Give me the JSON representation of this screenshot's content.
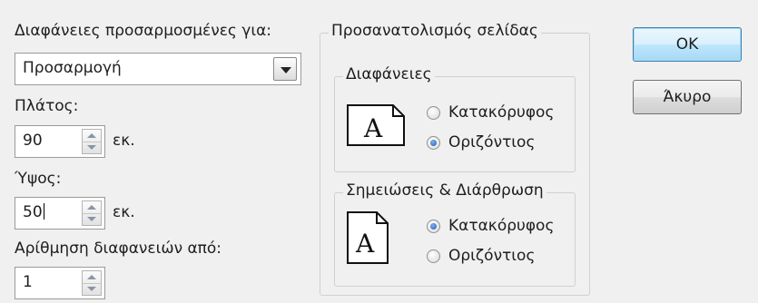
{
  "slides_sized_for": {
    "label": "Διαφάνειες προσαρμοσμένες για:",
    "value": "Προσαρμογή"
  },
  "width": {
    "label": "Πλάτος:",
    "value": "90",
    "unit": "εκ."
  },
  "height": {
    "label": "Ύψος:",
    "value": "50",
    "unit": "εκ."
  },
  "numbering": {
    "label": "Αρίθμηση διαφανειών από:",
    "value": "1"
  },
  "orientation": {
    "title": "Προσανατολισμός σελίδας",
    "slides": {
      "title": "Διαφάνειες",
      "options": [
        "Κατακόρυφος",
        "Οριζόντιος"
      ],
      "selected": "Οριζόντιος"
    },
    "notes": {
      "title": "Σημειώσεις & Διάρθρωση",
      "options": [
        "Κατακόρυφος",
        "Οριζόντιος"
      ],
      "selected": "Κατακόρυφος"
    },
    "icon_glyph": "A"
  },
  "buttons": {
    "ok": "OK",
    "cancel": "Άκυρο"
  },
  "colors": {
    "dialog_bg": "#f0f0f0",
    "default_button_border": "#3c7fb1",
    "radio_selected": "#1c5ab5"
  }
}
